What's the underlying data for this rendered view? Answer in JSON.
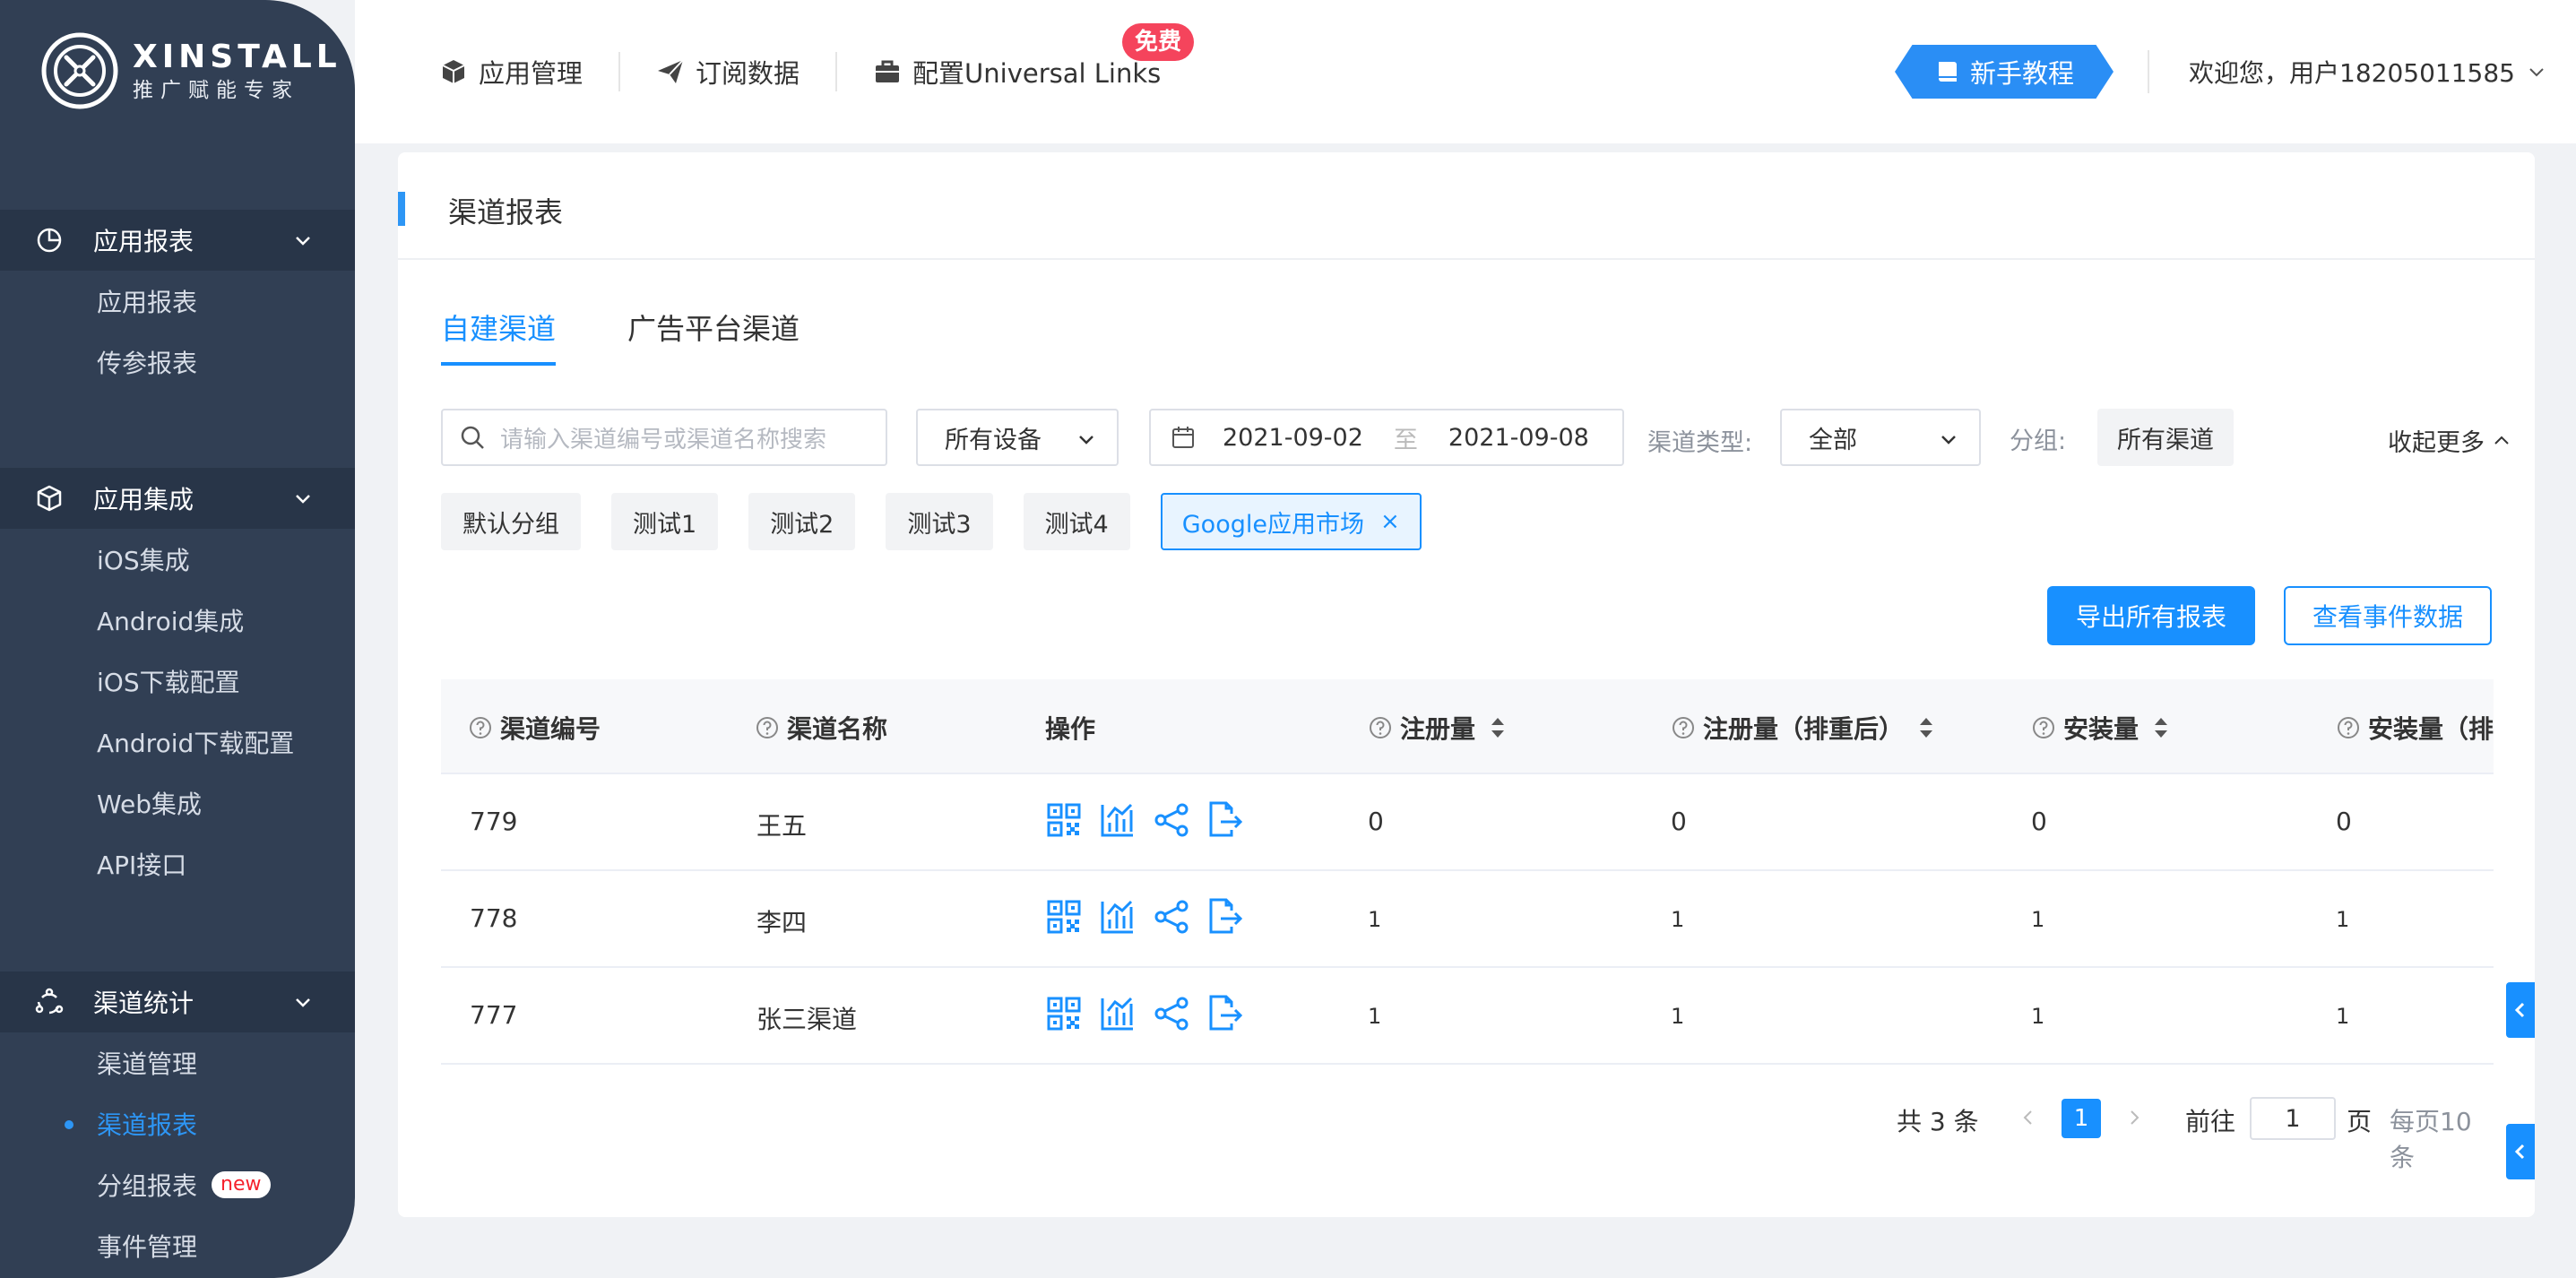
{
  "brand": {
    "name": "XINSTALL",
    "tagline": "推广赋能专家"
  },
  "sidebar": {
    "groups": [
      {
        "title": "应用报表",
        "icon": "pie-chart-icon",
        "items": [
          {
            "label": "应用报表"
          },
          {
            "label": "传参报表"
          }
        ]
      },
      {
        "title": "应用集成",
        "icon": "cube-icon",
        "items": [
          {
            "label": "iOS集成"
          },
          {
            "label": "Android集成"
          },
          {
            "label": "iOS下载配置"
          },
          {
            "label": "Android下载配置"
          },
          {
            "label": "Web集成"
          },
          {
            "label": "API接口"
          }
        ]
      },
      {
        "title": "渠道统计",
        "icon": "share-nodes-icon",
        "items": [
          {
            "label": "渠道管理"
          },
          {
            "label": "渠道报表",
            "active": true
          },
          {
            "label": "分组报表",
            "badge": "new"
          },
          {
            "label": "事件管理"
          }
        ]
      }
    ]
  },
  "topbar": {
    "menu": [
      {
        "label": "应用管理",
        "icon": "cube-icon"
      },
      {
        "label": "订阅数据",
        "icon": "paper-plane-icon"
      },
      {
        "label": "配置Universal Links",
        "icon": "briefcase-icon"
      }
    ],
    "free_badge": "免费",
    "tutorial_label": "新手教程",
    "welcome": "欢迎您，用户18205011585"
  },
  "page": {
    "title": "渠道报表",
    "tabs": [
      {
        "label": "自建渠道",
        "active": true
      },
      {
        "label": "广告平台渠道",
        "active": false
      }
    ]
  },
  "filters": {
    "search_placeholder": "请输入渠道编号或渠道名称搜索",
    "device": "所有设备",
    "date_start": "2021-09-02",
    "date_sep": "至",
    "date_end": "2021-09-08",
    "channel_type_label": "渠道类型:",
    "channel_type": "全部",
    "group_label": "分组:",
    "group_value": "所有渠道",
    "collapse": "收起更多"
  },
  "group_chips": [
    {
      "label": "默认分组"
    },
    {
      "label": "测试1"
    },
    {
      "label": "测试2"
    },
    {
      "label": "测试3"
    },
    {
      "label": "测试4"
    },
    {
      "label": "Google应用市场",
      "active": true
    }
  ],
  "actions": {
    "export": "导出所有报表",
    "events": "查看事件数据"
  },
  "table": {
    "columns": [
      "渠道编号",
      "渠道名称",
      "操作",
      "注册量",
      "注册量（排重后）",
      "安装量",
      "安装量（排"
    ],
    "rows": [
      {
        "id": "779",
        "name": "王五",
        "reg": "0",
        "reg_dedup": "0",
        "install": "0",
        "install_dedup": "0"
      },
      {
        "id": "778",
        "name": "李四",
        "reg": "1",
        "reg_dedup": "1",
        "install": "1",
        "install_dedup": "1"
      },
      {
        "id": "777",
        "name": "张三渠道",
        "reg": "1",
        "reg_dedup": "1",
        "install": "1",
        "install_dedup": "1"
      }
    ]
  },
  "pagination": {
    "total": "共 3 条",
    "current": "1",
    "goto_label": "前往",
    "goto_value": "1",
    "page_unit": "页",
    "per_page": "每页10条"
  },
  "colors": {
    "accent": "#1890ff",
    "sidebar": "#313f54",
    "sidebar_header": "#283548",
    "free_badge": "#f5445c"
  }
}
